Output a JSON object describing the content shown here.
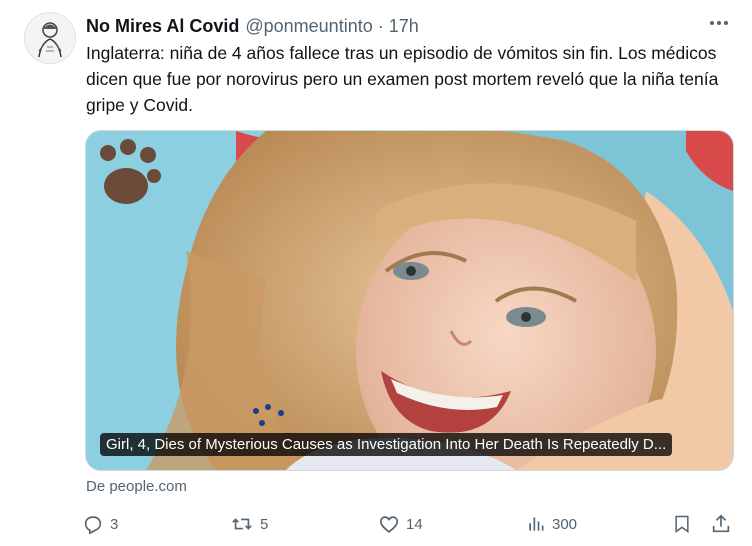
{
  "author": {
    "name": "No Mires Al Covid",
    "handle": "@ponmeuntinto",
    "separator": "·",
    "time": "17h",
    "avatar_icon": "sketch-portrait-avatar"
  },
  "tweet": {
    "text": "Inglaterra: niña de 4 años fallece tras un episodio de vómitos sin fin. Los médicos dicen que fue por norovirus pero un examen post mortem reveló que la niña tenía gripe y Covid."
  },
  "card": {
    "title": "Girl, 4, Dies of Mysterious Causes as Investigation Into Her Death Is Repeatedly D...",
    "source": "De people.com"
  },
  "actions": {
    "replies": "3",
    "reposts": "5",
    "likes": "14",
    "views": "300"
  },
  "icons": {
    "more": "more-horizontal-icon",
    "reply": "reply-icon",
    "repost": "repost-icon",
    "like": "heart-icon",
    "views": "views-chart-icon",
    "bookmark": "bookmark-icon",
    "share": "share-icon"
  },
  "colors": {
    "text": "#0f1419",
    "secondary": "#536471",
    "border": "#cfd9de"
  }
}
